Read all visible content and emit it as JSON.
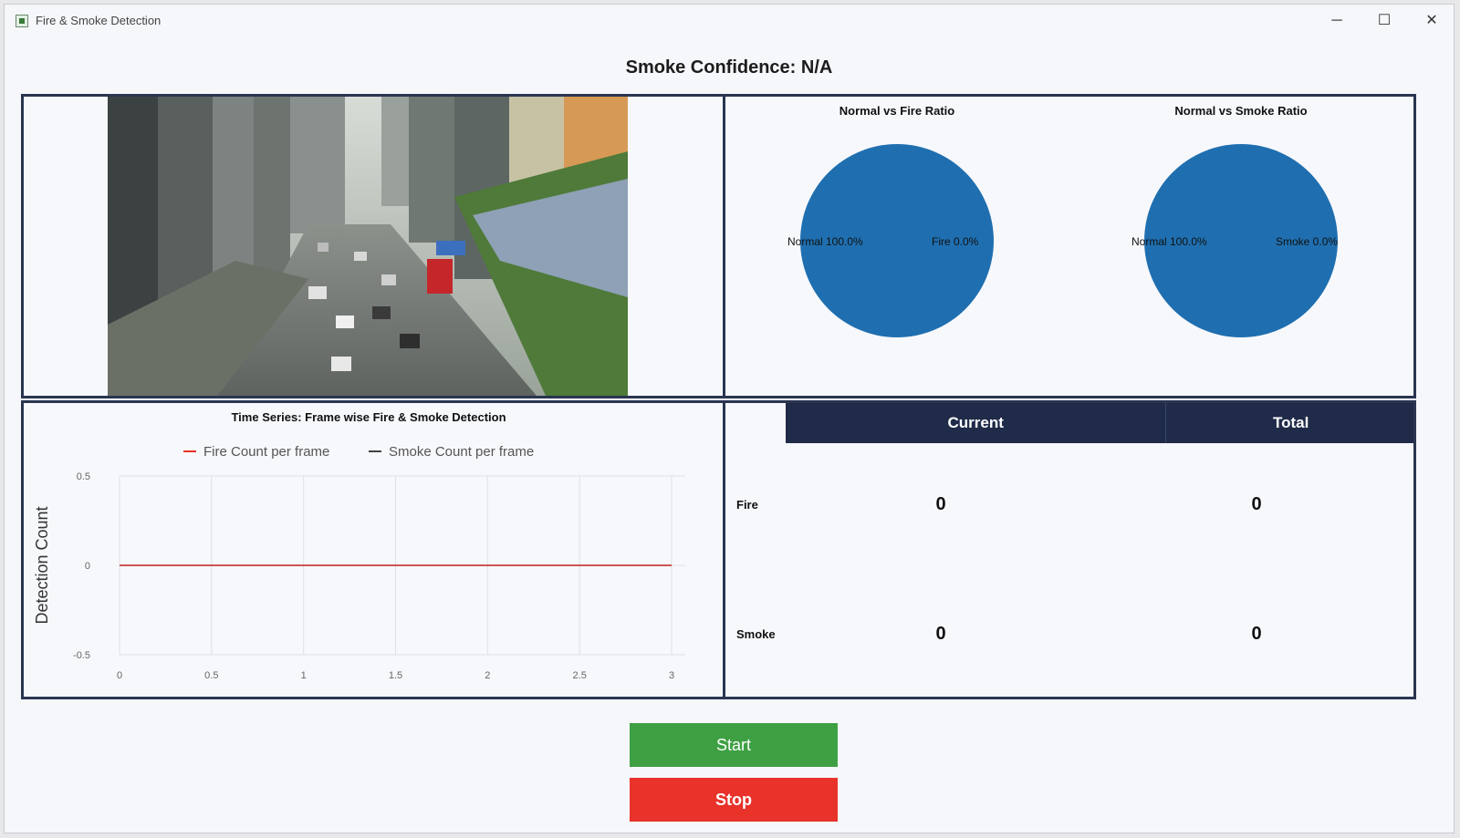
{
  "window": {
    "title": "Fire & Smoke Detection",
    "controls": {
      "minimize": "─",
      "maximize": "☐",
      "close": "✕"
    }
  },
  "header": {
    "status_text": "Smoke Confidence: N/A"
  },
  "pies": [
    {
      "title": "Normal vs Fire Ratio",
      "labels": [
        "Normal 100.0%",
        "Fire 0.0%"
      ],
      "values": [
        100,
        0
      ],
      "color": "#1f6fb0"
    },
    {
      "title": "Normal vs Smoke Ratio",
      "labels": [
        "Normal 100.0%",
        "Smoke 0.0%"
      ],
      "values": [
        100,
        0
      ],
      "color": "#1f6fb0"
    }
  ],
  "chart_data": {
    "type": "line",
    "title": "Time Series: Frame wise Fire & Smoke Detection",
    "xlabel": "",
    "ylabel": "Detection Count",
    "x": [
      0,
      1,
      2,
      3
    ],
    "xticks": [
      "0",
      "0.5",
      "1",
      "1.5",
      "2",
      "2.5",
      "3"
    ],
    "yticks": [
      "0.5",
      "0",
      "-0.5"
    ],
    "xlim": [
      0,
      3
    ],
    "ylim": [
      -0.5,
      0.5
    ],
    "grid": true,
    "legend_position": "top-center",
    "series": [
      {
        "name": "Fire Count per frame",
        "values": [
          0,
          0,
          0,
          0
        ],
        "color": "#e8322a"
      },
      {
        "name": "Smoke Count per frame",
        "values": [
          0,
          0,
          0,
          0
        ],
        "color": "#444444"
      }
    ]
  },
  "counts": {
    "headers": [
      "Current",
      "Total"
    ],
    "rows": [
      {
        "label": "Fire",
        "current": "0",
        "total": "0"
      },
      {
        "label": "Smoke",
        "current": "0",
        "total": "0"
      }
    ]
  },
  "buttons": {
    "start": "Start",
    "stop": "Stop"
  }
}
